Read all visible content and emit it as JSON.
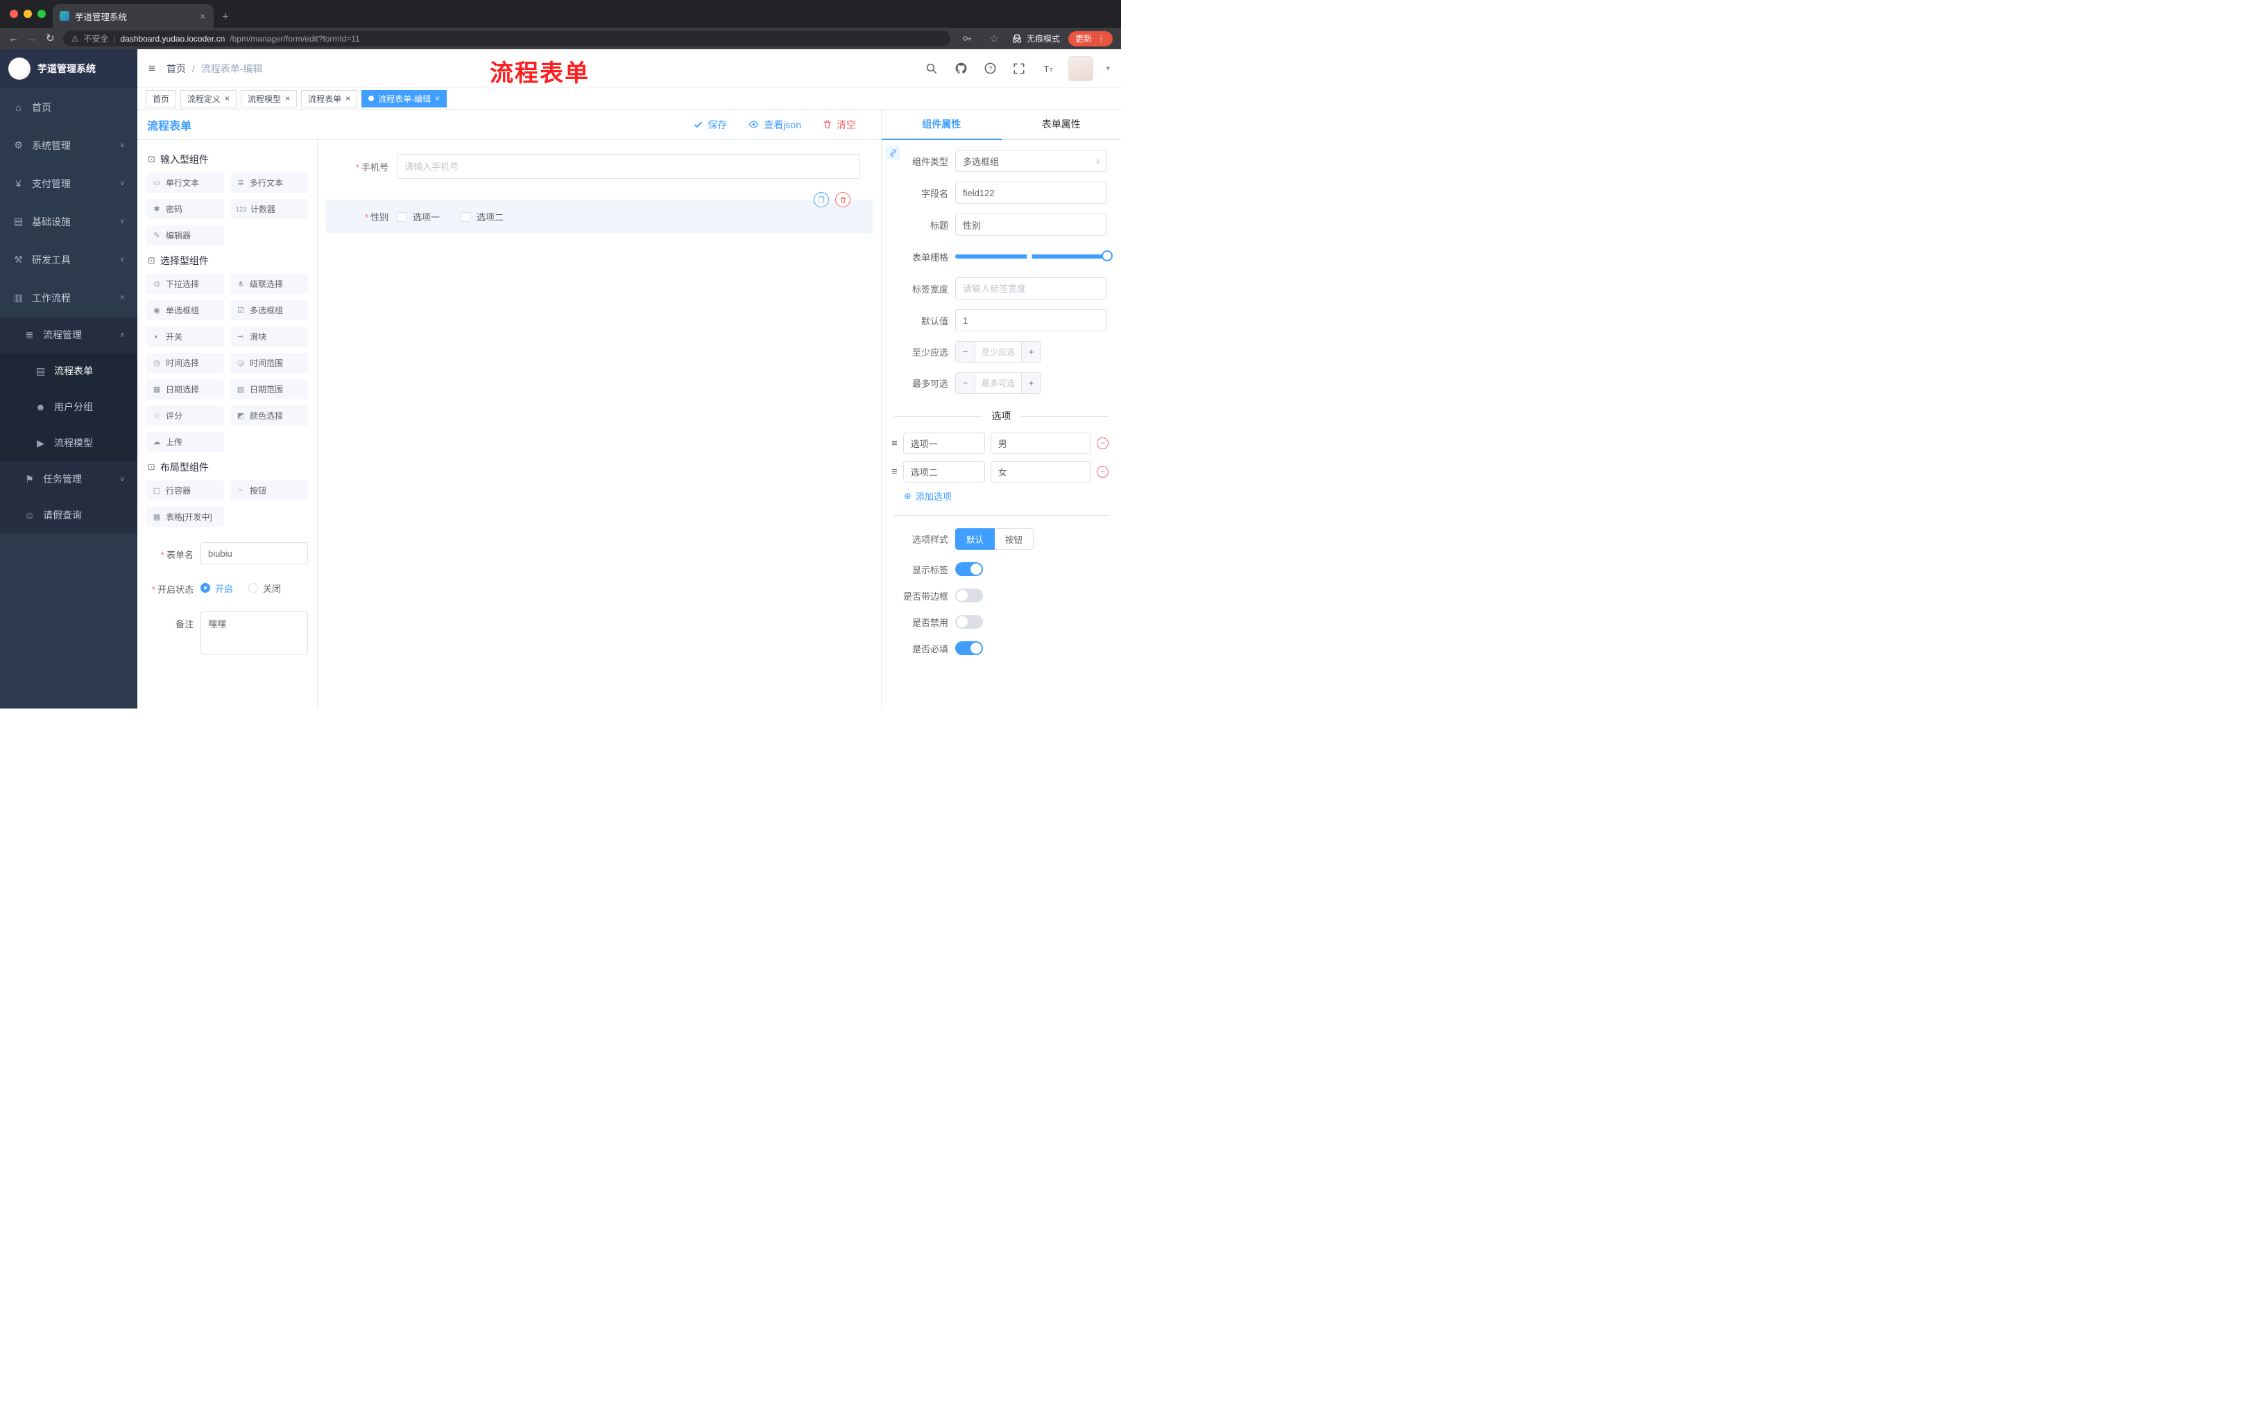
{
  "colors": {
    "accent": "#409eff",
    "danger": "#f56c6c",
    "annotation_red": "#ff1e1e",
    "sidebar_bg": "#2d394c",
    "update_pill": "#e8543f"
  },
  "browser": {
    "tab_title": "芋道管理系统",
    "security_label": "不安全",
    "url_domain": "dashboard.yudao.iocoder.cn",
    "url_path": "/bpm/manager/form/edit?formId=11",
    "incognito_label": "无痕模式",
    "update_label": "更新"
  },
  "annotation_text": "流程表单",
  "sidebar": {
    "app_title": "芋道管理系统",
    "items": [
      {
        "label": "首页",
        "glyph": "⌂",
        "chevron": ""
      },
      {
        "label": "系统管理",
        "glyph": "⚙",
        "chevron": "∨"
      },
      {
        "label": "支付管理",
        "glyph": "¥",
        "chevron": "∨"
      },
      {
        "label": "基础设施",
        "glyph": "▤",
        "chevron": "∨"
      },
      {
        "label": "研发工具",
        "glyph": "⚒",
        "chevron": "∨"
      },
      {
        "label": "工作流程",
        "glyph": "▥",
        "chevron": "∧"
      },
      {
        "label": "流程管理",
        "glyph": "≣",
        "chevron": "∧"
      },
      {
        "label": "流程表单",
        "glyph": "▤",
        "chevron": ""
      },
      {
        "label": "用户分组",
        "glyph": "☻",
        "chevron": ""
      },
      {
        "label": "流程模型",
        "glyph": "▶",
        "chevron": ""
      },
      {
        "label": "任务管理",
        "glyph": "⚑",
        "chevron": "∨"
      },
      {
        "label": "请假查询",
        "glyph": "☺",
        "chevron": ""
      }
    ]
  },
  "header": {
    "breadcrumb_home": "首页",
    "breadcrumb_sep": "/",
    "breadcrumb_current": "流程表单-编辑"
  },
  "tags": [
    {
      "label": "首页"
    },
    {
      "label": "流程定义"
    },
    {
      "label": "流程模型"
    },
    {
      "label": "流程表单"
    },
    {
      "label": "流程表单-编辑"
    }
  ],
  "designer": {
    "panel_title": "流程表单",
    "toolbar": {
      "save": "保存",
      "view_json": "查看json",
      "clear": "清空"
    },
    "palette_groups": [
      {
        "title": "输入型组件",
        "items": [
          {
            "label": "单行文本",
            "glyph": "▭"
          },
          {
            "label": "多行文本",
            "glyph": "≣"
          },
          {
            "label": "密码",
            "glyph": "✱"
          },
          {
            "label": "计数器",
            "glyph": "123"
          },
          {
            "label": "编辑器",
            "glyph": "✎"
          }
        ]
      },
      {
        "title": "选择型组件",
        "items": [
          {
            "label": "下拉选择",
            "glyph": "⊙"
          },
          {
            "label": "级联选择",
            "glyph": "⋔"
          },
          {
            "label": "单选框组",
            "glyph": "◉"
          },
          {
            "label": "多选框组",
            "glyph": "☑"
          },
          {
            "label": "开关",
            "glyph": "◐"
          },
          {
            "label": "滑块",
            "glyph": "⊸"
          },
          {
            "label": "时间选择",
            "glyph": "◷"
          },
          {
            "label": "时间范围",
            "glyph": "◶"
          },
          {
            "label": "日期选择",
            "glyph": "▦"
          },
          {
            "label": "日期范围",
            "glyph": "▧"
          },
          {
            "label": "评分",
            "glyph": "☆"
          },
          {
            "label": "颜色选择",
            "glyph": "◩"
          },
          {
            "label": "上传",
            "glyph": "☁"
          }
        ]
      },
      {
        "title": "布局型组件",
        "items": [
          {
            "label": "行容器",
            "glyph": "▢"
          },
          {
            "label": "按钮",
            "glyph": "☞"
          },
          {
            "label": "表格[开发中]",
            "glyph": "▦"
          }
        ]
      }
    ],
    "meta": {
      "form_name_label": "表单名",
      "form_name_value": "biubiu",
      "status_label": "开启状态",
      "status_on": "开启",
      "status_off": "关闭",
      "remark_label": "备注",
      "remark_value": "嘿嘿"
    },
    "canvas": {
      "phone_label": "手机号",
      "phone_placeholder": "请输入手机号",
      "gender_label": "性别",
      "gender_opt1": "选项一",
      "gender_opt2": "选项二"
    }
  },
  "properties": {
    "tab_component": "组件属性",
    "tab_form": "表单属性",
    "rows": {
      "component_type_label": "组件类型",
      "component_type_value": "多选框组",
      "field_name_label": "字段名",
      "field_name_value": "field122",
      "title_label": "标题",
      "title_value": "性别",
      "grid_label": "表单栅格",
      "label_width_label": "标签宽度",
      "label_width_placeholder": "请输入标签宽度",
      "default_label": "默认值",
      "default_value": "1",
      "min_label": "至少应选",
      "min_placeholder": "至少应选",
      "max_label": "最多可选",
      "max_placeholder": "最多可选"
    },
    "options": {
      "divider_title": "选项",
      "rows": [
        {
          "label": "选项一",
          "value": "男"
        },
        {
          "label": "选项二",
          "value": "女"
        }
      ],
      "add_label": "添加选项"
    },
    "style_label": "选项样式",
    "style_default": "默认",
    "style_button": "按钮",
    "switch_show_label": "显示标签",
    "switch_border": "是否带边框",
    "switch_disabled": "是否禁用",
    "switch_required": "是否必填"
  }
}
